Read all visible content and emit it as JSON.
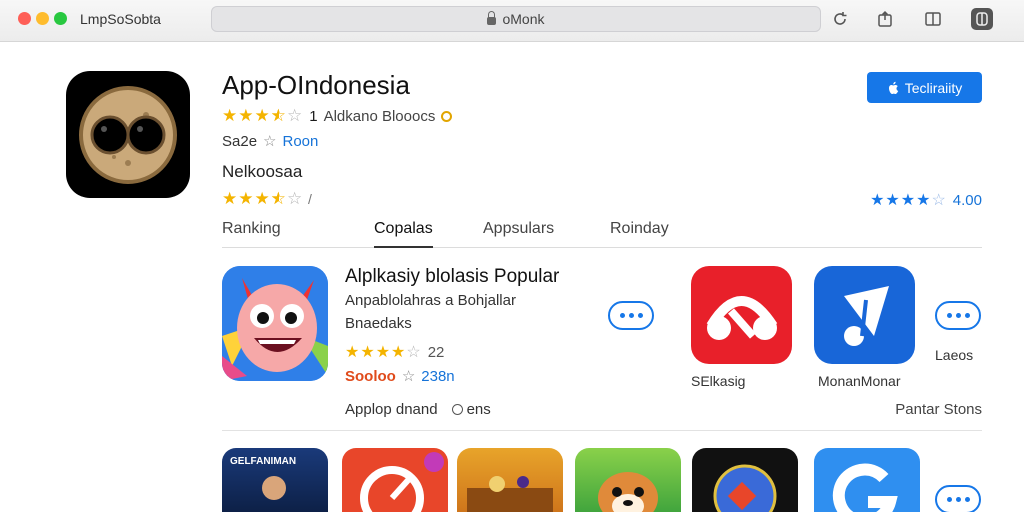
{
  "window": {
    "title": "LmpSoSobta",
    "address": "oMonk"
  },
  "app": {
    "title": "App-OIndonesia",
    "rating_stars": 3.5,
    "rating_count": "1",
    "developer": "Aldkano Blooocs",
    "price_text": "Sa2e",
    "secondary_value": "Roon",
    "subtitle": "Nelkoosaa",
    "rating2_stars": 3.5,
    "rating2_suffix": "/",
    "get_button_label": "Tecliraiity",
    "right_rating_stars": 4,
    "right_rating_value": "4.00"
  },
  "tabs": [
    {
      "label": "Ranking"
    },
    {
      "label": "Copalas"
    },
    {
      "label": "Appsulars"
    },
    {
      "label": "Roinday"
    }
  ],
  "featured": {
    "title": "Alplkasiy blolasis Popular",
    "subtitle": "Anpablolahras a Bohjallar",
    "subtitle2": "Bnaedaks",
    "rating_stars": 4,
    "rating_count": "22",
    "price_red": "Sooloo",
    "price_blue": "238n",
    "bottom_left": "Applop dnand",
    "bottom_mid": "ens",
    "right_link": "Pantar Stons",
    "tile_labels": [
      "SElkasig",
      "MonanMonar",
      "Laeos"
    ]
  },
  "lower_row": {
    "first_tile_caption": "GELFANIMAN"
  },
  "colors": {
    "accent": "#1677e8",
    "star": "#f4b400",
    "price_red": "#e04b1b"
  }
}
